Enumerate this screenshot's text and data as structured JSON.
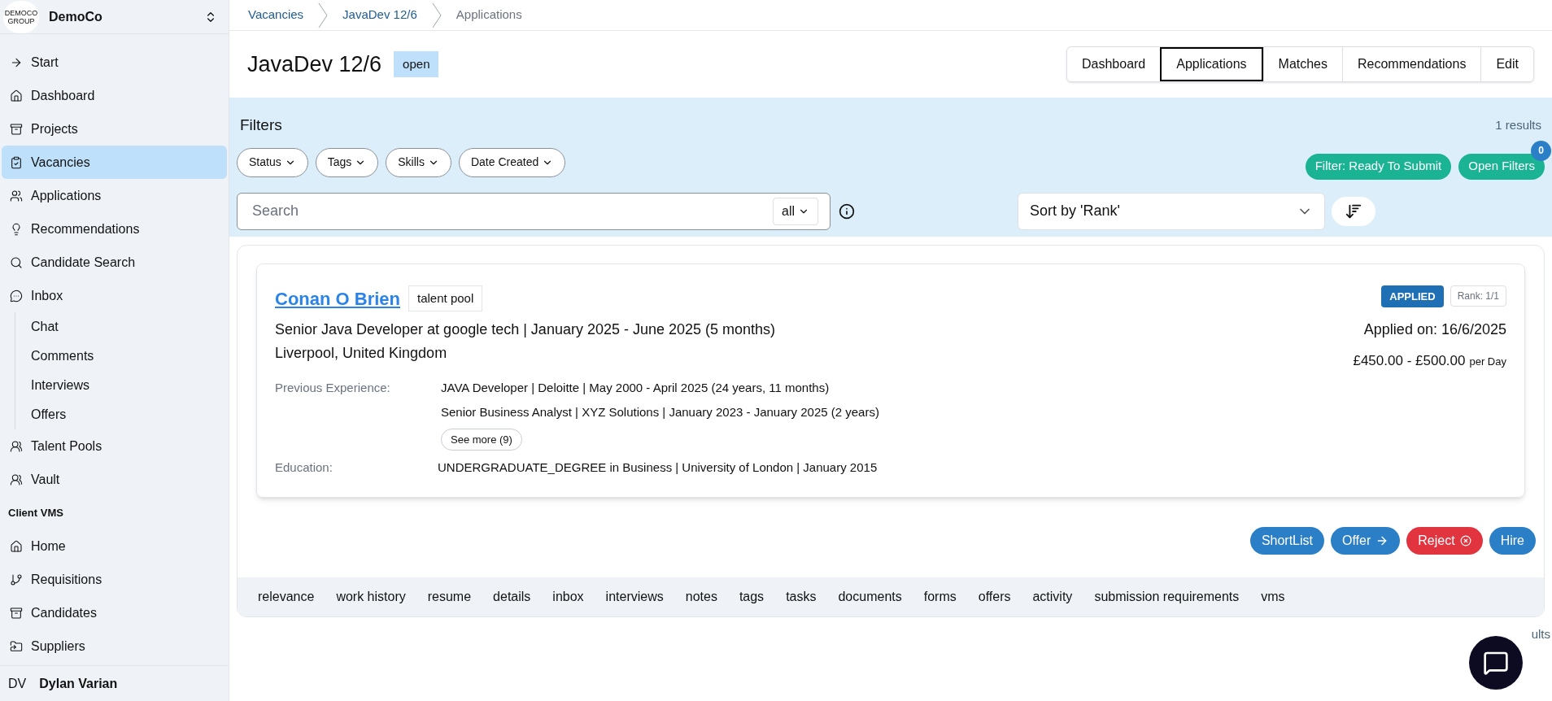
{
  "sidebar": {
    "org": {
      "logo_text": "DEMOCO GROUP",
      "name": "DemoCo"
    },
    "sections": [
      {
        "items": [
          {
            "label": "Start",
            "selected": false
          },
          {
            "label": "Dashboard",
            "selected": false
          },
          {
            "label": "Projects",
            "selected": false
          },
          {
            "label": "Vacancies",
            "selected": true
          },
          {
            "label": "Applications",
            "selected": false
          },
          {
            "label": "Recommendations",
            "selected": false
          },
          {
            "label": "Candidate Search",
            "selected": false
          },
          {
            "label": "Inbox",
            "selected": false,
            "children": [
              {
                "label": "Chat",
                "selected": false
              },
              {
                "label": "Comments",
                "selected": false
              },
              {
                "label": "Interviews",
                "selected": false
              },
              {
                "label": "Offers",
                "selected": false
              }
            ]
          },
          {
            "label": "Talent Pools",
            "selected": false
          },
          {
            "label": "Vault",
            "selected": false
          }
        ]
      },
      {
        "heading": "Client VMS",
        "items": [
          {
            "label": "Home",
            "selected": false
          },
          {
            "label": "Requisitions",
            "selected": false
          },
          {
            "label": "Candidates",
            "selected": false
          },
          {
            "label": "Suppliers",
            "selected": false
          }
        ]
      }
    ],
    "user": {
      "initials": "DV",
      "name": "Dylan Varian"
    }
  },
  "breadcrumbs": [
    "Vacancies",
    "JavaDev 12/6",
    "Applications"
  ],
  "page": {
    "title": "JavaDev 12/6",
    "status": "open",
    "tabs": [
      {
        "label": "Dashboard",
        "selected": false
      },
      {
        "label": "Applications",
        "selected": true
      },
      {
        "label": "Matches",
        "selected": false
      },
      {
        "label": "Recommendations",
        "selected": false
      },
      {
        "label": "Edit",
        "selected": false
      }
    ]
  },
  "filters": {
    "title": "Filters",
    "results": "1 results",
    "dropdowns": [
      "Status",
      "Tags",
      "Skills",
      "Date Created"
    ],
    "ready_button": "Filter: Ready To Submit",
    "open_button": "Open Filters",
    "open_count": "0",
    "search": {
      "placeholder": "Search",
      "scope": "all"
    },
    "sort": "Sort by 'Rank'"
  },
  "application": {
    "name": "Conan O Brien",
    "tag": "talent pool",
    "status": "APPLIED",
    "rank": "Rank: 1/1",
    "headline": "Senior Java Developer at google tech | January 2025 - June 2025 (5 months)",
    "location": "Liverpool, United Kingdom",
    "applied_on": "Applied on: 16/6/2025",
    "rate": "£450.00 - £500.00",
    "rate_unit": "per Day",
    "experience_label": "Previous Experience:",
    "experience": [
      "JAVA Developer | Deloitte | May 2000 - April 2025 (24 years, 11 months)",
      "Senior Business Analyst | XYZ Solutions | January 2023 - January 2025 (2 years)"
    ],
    "see_more": "See more (9)",
    "education_label": "Education:",
    "education": "UNDERGRADUATE_DEGREE in Business | University of London | January 2015",
    "actions": [
      {
        "label": "ShortList",
        "kind": "shortlist"
      },
      {
        "label": "Offer",
        "kind": "offer"
      },
      {
        "label": "Reject",
        "kind": "reject"
      },
      {
        "label": "Hire",
        "kind": "hire"
      }
    ],
    "tabs": [
      "relevance",
      "work history",
      "resume",
      "details",
      "inbox",
      "interviews",
      "notes",
      "tags",
      "tasks",
      "documents",
      "forms",
      "offers",
      "activity",
      "submission requirements",
      "vms"
    ]
  },
  "footer_results": "ults"
}
